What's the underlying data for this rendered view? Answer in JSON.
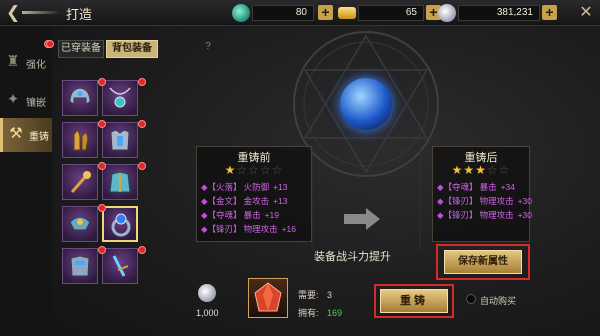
{
  "header": {
    "back_arrow": "❮",
    "title": "打造",
    "close": "✕"
  },
  "resources": {
    "jade": "80",
    "gold": "65",
    "silver": "381,231",
    "plus": "+"
  },
  "sidebar": {
    "items": [
      {
        "label": "强化",
        "icon": "♜"
      },
      {
        "label": "镶嵌",
        "icon": "✦"
      },
      {
        "label": "重铸",
        "icon": "⚒"
      }
    ]
  },
  "tabs": {
    "equipped": "已穿装备",
    "bag": "背包装备"
  },
  "help": "?",
  "before": {
    "title": "重铸前",
    "stars_on": "★",
    "stars_off": "☆☆☆☆",
    "star_count": 1,
    "lines": [
      {
        "tag": "【火落】",
        "name": "火防御",
        "val": "+13"
      },
      {
        "tag": "【金文】",
        "name": "金攻击",
        "val": "+13"
      },
      {
        "tag": "【夺魂】",
        "name": "暴击",
        "val": "+19"
      },
      {
        "tag": "【锋刃】",
        "name": "物理攻击",
        "val": "+16"
      }
    ]
  },
  "after": {
    "title": "重铸后",
    "stars_on": "★★★",
    "stars_off": "☆☆",
    "star_count": 3,
    "lines": [
      {
        "tag": "【夺魂】",
        "name": "暴击",
        "val": "+34"
      },
      {
        "tag": "【锋刃】",
        "name": "物理攻击",
        "val": "+30"
      },
      {
        "tag": "【锋刃】",
        "name": "物理攻击",
        "val": "+30"
      }
    ]
  },
  "boost_text": "装备战斗力提升",
  "save_button": "保存新属性",
  "cost": {
    "silver": "1,000",
    "need_label": "需要:",
    "need_value": "3",
    "own_label": "拥有:",
    "own_value": "169"
  },
  "reforge_button": "重铸",
  "auto_buy": "自动购买",
  "colors": {
    "accent_gold": "#cbb37a",
    "stat_purple": "#d163e8",
    "highlight_red": "#d62a2a",
    "own_green": "#4fd05a"
  }
}
